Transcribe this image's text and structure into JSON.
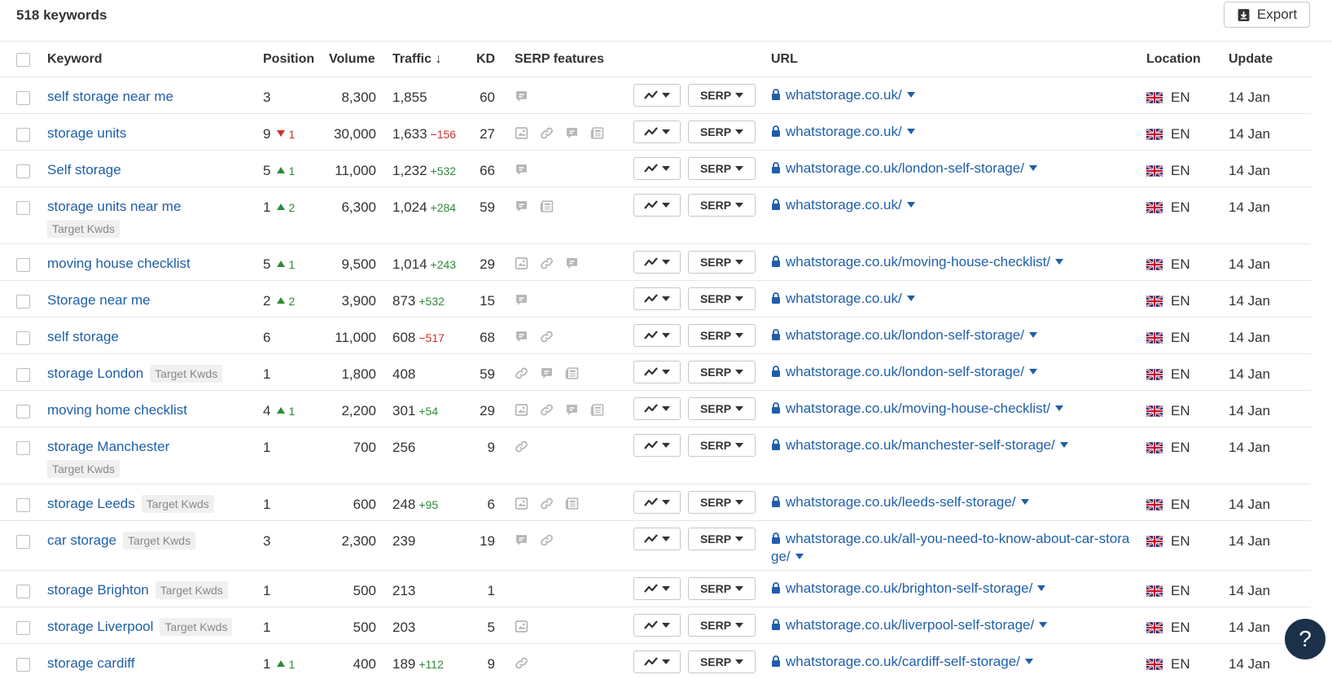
{
  "header": {
    "count": "518 keywords",
    "export_label": "Export"
  },
  "columns": {
    "keyword": "Keyword",
    "position": "Position",
    "volume": "Volume",
    "traffic": "Traffic ↓",
    "kd": "KD",
    "serp": "SERP features",
    "url": "URL",
    "location": "Location",
    "update": "Update"
  },
  "serp_button": "SERP",
  "rows": [
    {
      "keyword": "self storage near me",
      "tag": "",
      "position": "3",
      "pos_dir": "",
      "pos_delta": "",
      "volume": "8,300",
      "traffic": "1,855",
      "traffic_delta": "",
      "traffic_dir": "",
      "kd": "60",
      "serp": [
        "review-icon"
      ],
      "url": "whatstorage.co.uk/",
      "lang": "EN",
      "update": "14 Jan",
      "h": 45
    },
    {
      "keyword": "storage units",
      "tag": "",
      "position": "9",
      "pos_dir": "down",
      "pos_delta": "1",
      "volume": "30,000",
      "traffic": "1,633",
      "traffic_delta": "−156",
      "traffic_dir": "down",
      "kd": "27",
      "serp": [
        "image-icon",
        "link-icon",
        "review-icon",
        "news-icon"
      ],
      "url": "whatstorage.co.uk/",
      "lang": "EN",
      "update": "14 Jan",
      "h": 45
    },
    {
      "keyword": "Self storage",
      "tag": "",
      "position": "5",
      "pos_dir": "up",
      "pos_delta": "1",
      "volume": "11,000",
      "traffic": "1,232",
      "traffic_delta": "+532",
      "traffic_dir": "up",
      "kd": "66",
      "serp": [
        "review-icon"
      ],
      "url": "whatstorage.co.uk/london-self-storage/",
      "lang": "EN",
      "update": "14 Jan",
      "h": 45
    },
    {
      "keyword": "storage units near me",
      "tag": "Target Kwds",
      "position": "1",
      "pos_dir": "up",
      "pos_delta": "2",
      "volume": "6,300",
      "traffic": "1,024",
      "traffic_delta": "+284",
      "traffic_dir": "up",
      "kd": "59",
      "serp": [
        "review-icon",
        "news-icon"
      ],
      "url": "whatstorage.co.uk/",
      "lang": "EN",
      "update": "14 Jan",
      "h": 70
    },
    {
      "keyword": "moving house checklist",
      "tag": "",
      "position": "5",
      "pos_dir": "up",
      "pos_delta": "1",
      "volume": "9,500",
      "traffic": "1,014",
      "traffic_delta": "+243",
      "traffic_dir": "up",
      "kd": "29",
      "serp": [
        "image-icon",
        "link-icon",
        "review-icon"
      ],
      "url": "whatstorage.co.uk/moving-house-checklist/",
      "lang": "EN",
      "update": "14 Jan",
      "h": 45
    },
    {
      "keyword": "Storage near me",
      "tag": "",
      "position": "2",
      "pos_dir": "up",
      "pos_delta": "2",
      "volume": "3,900",
      "traffic": "873",
      "traffic_delta": "+532",
      "traffic_dir": "up",
      "kd": "15",
      "serp": [
        "review-icon"
      ],
      "url": "whatstorage.co.uk/",
      "lang": "EN",
      "update": "14 Jan",
      "h": 45
    },
    {
      "keyword": "self storage",
      "tag": "",
      "position": "6",
      "pos_dir": "",
      "pos_delta": "",
      "volume": "11,000",
      "traffic": "608",
      "traffic_delta": "−517",
      "traffic_dir": "down",
      "kd": "68",
      "serp": [
        "review-icon",
        "link-icon"
      ],
      "url": "whatstorage.co.uk/london-self-storage/",
      "lang": "EN",
      "update": "14 Jan",
      "h": 45
    },
    {
      "keyword": "storage London",
      "tag": "Target Kwds",
      "position": "1",
      "pos_dir": "",
      "pos_delta": "",
      "volume": "1,800",
      "traffic": "408",
      "traffic_delta": "",
      "traffic_dir": "",
      "kd": "59",
      "serp": [
        "link-icon",
        "review-icon",
        "news-icon"
      ],
      "url": "whatstorage.co.uk/london-self-storage/",
      "lang": "EN",
      "update": "14 Jan",
      "h": 45
    },
    {
      "keyword": "moving home checklist",
      "tag": "",
      "position": "4",
      "pos_dir": "up",
      "pos_delta": "1",
      "volume": "2,200",
      "traffic": "301",
      "traffic_delta": "+54",
      "traffic_dir": "up",
      "kd": "29",
      "serp": [
        "image-icon",
        "link-icon",
        "review-icon",
        "news-icon"
      ],
      "url": "whatstorage.co.uk/moving-house-checklist/",
      "lang": "EN",
      "update": "14 Jan",
      "h": 45
    },
    {
      "keyword": "storage Manchester",
      "tag": "Target Kwds",
      "position": "1",
      "pos_dir": "",
      "pos_delta": "",
      "volume": "700",
      "traffic": "256",
      "traffic_delta": "",
      "traffic_dir": "",
      "kd": "9",
      "serp": [
        "link-icon"
      ],
      "url": "whatstorage.co.uk/manchester-self-storage/",
      "lang": "EN",
      "update": "14 Jan",
      "h": 70
    },
    {
      "keyword": "storage Leeds",
      "tag": "Target Kwds",
      "position": "1",
      "pos_dir": "",
      "pos_delta": "",
      "volume": "600",
      "traffic": "248",
      "traffic_delta": "+95",
      "traffic_dir": "up",
      "kd": "6",
      "serp": [
        "image-icon",
        "link-icon",
        "news-icon"
      ],
      "url": "whatstorage.co.uk/leeds-self-storage/",
      "lang": "EN",
      "update": "14 Jan",
      "h": 45
    },
    {
      "keyword": "car storage",
      "tag": "Target Kwds",
      "position": "3",
      "pos_dir": "",
      "pos_delta": "",
      "volume": "2,300",
      "traffic": "239",
      "traffic_delta": "",
      "traffic_dir": "",
      "kd": "19",
      "serp": [
        "review-icon",
        "link-icon"
      ],
      "url": "whatstorage.co.uk/all-you-need-to-know-about-car-storage/",
      "lang": "EN",
      "update": "14 Jan",
      "h": 61
    },
    {
      "keyword": "storage Brighton",
      "tag": "Target Kwds",
      "position": "1",
      "pos_dir": "",
      "pos_delta": "",
      "volume": "500",
      "traffic": "213",
      "traffic_delta": "",
      "traffic_dir": "",
      "kd": "1",
      "serp": [],
      "url": "whatstorage.co.uk/brighton-self-storage/",
      "lang": "EN",
      "update": "14 Jan",
      "h": 45
    },
    {
      "keyword": "storage Liverpool",
      "tag": "Target Kwds",
      "position": "1",
      "pos_dir": "",
      "pos_delta": "",
      "volume": "500",
      "traffic": "203",
      "traffic_delta": "",
      "traffic_dir": "",
      "kd": "5",
      "serp": [
        "image-icon"
      ],
      "url": "whatstorage.co.uk/liverpool-self-storage/",
      "lang": "EN",
      "update": "14 Jan",
      "h": 45
    },
    {
      "keyword": "storage cardiff",
      "tag": "",
      "position": "1",
      "pos_dir": "up",
      "pos_delta": "1",
      "volume": "400",
      "traffic": "189",
      "traffic_delta": "+112",
      "traffic_dir": "up",
      "kd": "9",
      "serp": [
        "link-icon"
      ],
      "url": "whatstorage.co.uk/cardiff-self-storage/",
      "lang": "EN",
      "update": "14 Jan",
      "h": 45
    }
  ],
  "help_label": "?",
  "colors": {
    "link": "#1f5fa8",
    "positive": "#2e8b3a",
    "negative": "#d0312d",
    "help_bg": "#1b3049"
  }
}
